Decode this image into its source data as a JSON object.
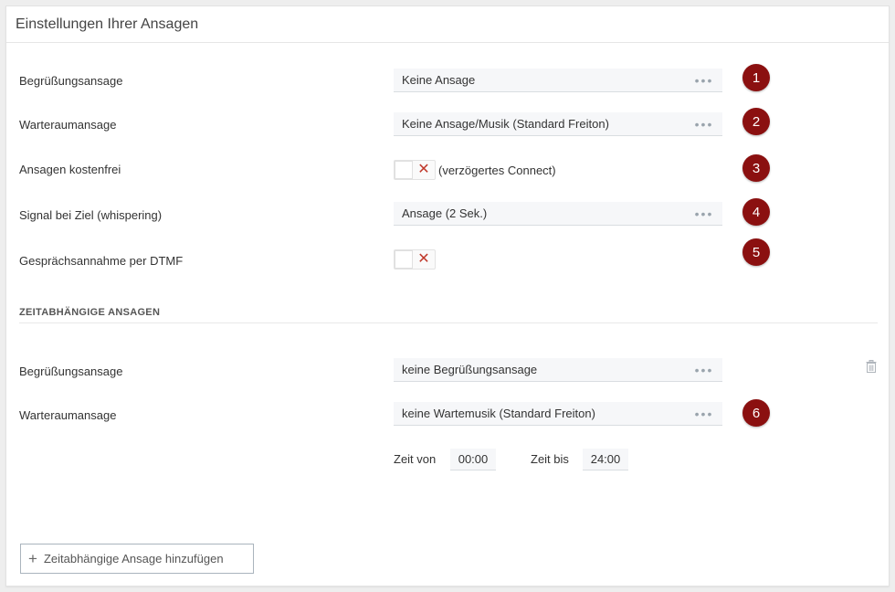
{
  "panel": {
    "title": "Einstellungen Ihrer Ansagen"
  },
  "rows": [
    {
      "label": "Begrüßungsansage",
      "value": "Keine Ansage",
      "badge": "1"
    },
    {
      "label": "Warteraumansage",
      "value": "Keine Ansage/Musik (Standard Freiton)",
      "badge": "2"
    },
    {
      "label": "Ansagen kostenfrei",
      "toggle_note": "(verzögertes Connect)",
      "badge": "3"
    },
    {
      "label": "Signal bei Ziel (whispering)",
      "value": "Ansage (2 Sek.)",
      "badge": "4"
    },
    {
      "label": "Gesprächsannahme per DTMF",
      "badge": "5"
    }
  ],
  "time_section": {
    "title": "ZEITABHÄNGIGE ANSAGEN",
    "rows": [
      {
        "label": "Begrüßungsansage",
        "value": "keine Begrüßungsansage"
      },
      {
        "label": "Warteraumansage",
        "value": "keine Wartemusik (Standard Freiton)",
        "badge": "6"
      }
    ],
    "time_from_label": "Zeit von",
    "time_from": "00:00",
    "time_to_label": "Zeit bis",
    "time_to": "24:00"
  },
  "dots": "•••",
  "toggle_off_glyph": "✕",
  "add_button": {
    "plus": "+",
    "label": "Zeitabhängige Ansage hinzufügen"
  },
  "colors": {
    "badge": "#8b1010",
    "toggle_off": "#c0392b"
  }
}
